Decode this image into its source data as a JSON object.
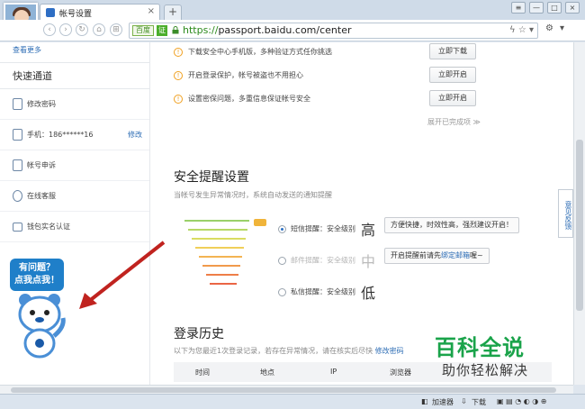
{
  "browser": {
    "tab_title": "帐号设置",
    "tab_close": "×",
    "new_tab": "+",
    "address": {
      "badge": "百度",
      "verified": "证",
      "scheme": "https://",
      "url_rest": "passport.baidu.com/center"
    },
    "window_controls": [
      "≡",
      "—",
      "□",
      "×"
    ]
  },
  "sidebar": {
    "more_link": "查看更多",
    "quick_title": "快速通道",
    "items": [
      {
        "label": "修改密码",
        "icon": "lock-icon"
      },
      {
        "label": "手机：186******16",
        "action": "修改",
        "icon": "phone-icon"
      },
      {
        "label": "帐号申诉",
        "icon": "edit-icon"
      },
      {
        "label": "在线客服",
        "icon": "question-icon"
      },
      {
        "label": "钱包实名认证",
        "icon": "id-card-icon"
      }
    ],
    "helper_bubble": [
      "有问题？",
      "点我点我！"
    ]
  },
  "security_tips": [
    {
      "text": "下载安全中心手机版，多种验证方式任你挑选",
      "button": "立即下载"
    },
    {
      "text": "开启登录保护，帐号被盗也不用担心",
      "button": "立即开启"
    },
    {
      "text": "设置密保问题，多重信息保证帐号安全",
      "button": "立即开启"
    }
  ],
  "expand_text": "展开已完成项 ≫",
  "alert_settings": {
    "title": "安全提醒设置",
    "desc": "当帐号发生异常情况时，系统自动发送的通知提醒",
    "options": [
      {
        "label": "短信提醒：安全级别",
        "level": "高",
        "selected": true,
        "tip": "方便快捷，时效性高，强烈建议开启！"
      },
      {
        "label": "邮件提醒：安全级别",
        "level": "中",
        "selected": false,
        "tip_prefix": "开启提醒前请先",
        "tip_link": "绑定邮箱",
        "tip_suffix": "喔~"
      },
      {
        "label": "私信提醒：安全级别",
        "level": "低",
        "selected": false
      }
    ]
  },
  "login_history": {
    "title": "登录历史",
    "desc": "以下为您最近1次登录记录，若存在异常情况，请在核实后尽快",
    "link": "修改密码",
    "columns": [
      "时间",
      "地点",
      "IP",
      "浏览器"
    ]
  },
  "feedback_tab": "意见反馈",
  "status_bar": {
    "accelerator": "加速器",
    "download": "下载"
  },
  "watermark": {
    "line1": "百科全说",
    "line2": "助你轻松解决"
  }
}
